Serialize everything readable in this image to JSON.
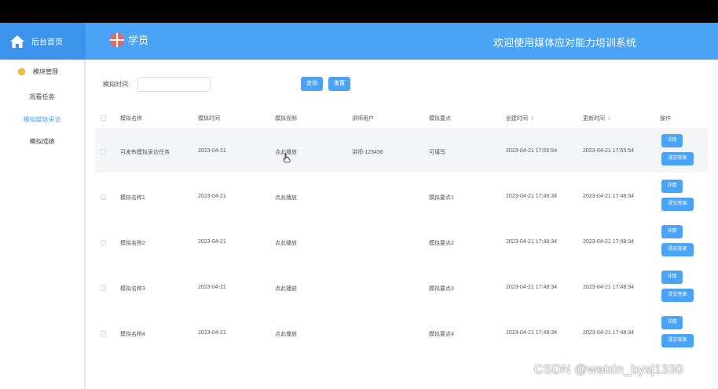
{
  "header": {
    "home_label": "后台首页",
    "role_label": "学员",
    "system_title": "欢迎使用媒体应对能力培训系统",
    "color": "#4aa3f7"
  },
  "sidebar": {
    "group_label": "模块管理",
    "items": [
      {
        "label": "观看任务"
      },
      {
        "label": "模拟媒体采访"
      },
      {
        "label": "模拟成绩"
      }
    ],
    "active_index": 1
  },
  "search": {
    "label": "模拟时间:",
    "value": "",
    "query_button": "查询",
    "reset_button": "重置"
  },
  "table": {
    "columns": [
      "模拟名称",
      "模拟时间",
      "模拟视频",
      "讲师用户",
      "模拟要点",
      "创建时间",
      "更新时间",
      "操作"
    ],
    "rows": [
      {
        "name": "可发布模拟采访任务",
        "time": "2023-04-21",
        "video": "点此播放",
        "teacher": "讲师-123456",
        "point": "可填写",
        "created": "2023-04-21 17:55:54",
        "updated": "2023-04-21 17:55:54"
      },
      {
        "name": "模拟名称1",
        "time": "2023-04-21",
        "video": "点此播放",
        "teacher": "",
        "point": "模拟要点1",
        "created": "2023-04-21 17:48:34",
        "updated": "2023-04-21 17:48:34"
      },
      {
        "name": "模拟名称2",
        "time": "2023-04-21",
        "video": "点此播放",
        "teacher": "",
        "point": "模拟要点2",
        "created": "2023-04-21 17:48:34",
        "updated": "2023-04-21 17:48:34"
      },
      {
        "name": "模拟名称3",
        "time": "2023-04-21",
        "video": "点此播放",
        "teacher": "",
        "point": "模拟要点3",
        "created": "2023-04-21 17:48:34",
        "updated": "2023-04-21 17:48:34"
      },
      {
        "name": "模拟名称4",
        "time": "2023-04-21",
        "video": "点此播放",
        "teacher": "",
        "point": "模拟要点4",
        "created": "2023-04-21 17:48:34",
        "updated": "2023-04-21 17:48:34"
      }
    ],
    "detail_button": "详情",
    "submit_button": "提交答案"
  },
  "watermark": "CSDN @weixin_bysj1330"
}
